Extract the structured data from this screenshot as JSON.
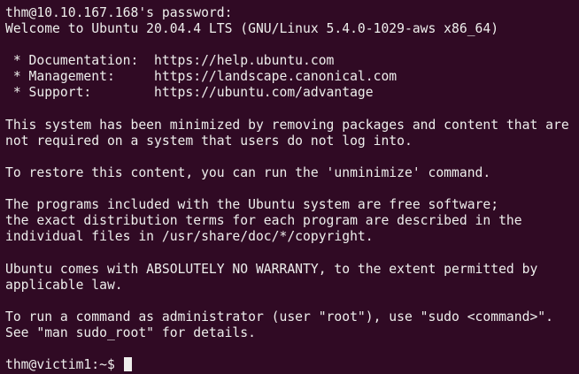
{
  "terminal": {
    "lines": [
      "thm@10.10.167.168's password:",
      "Welcome to Ubuntu 20.04.4 LTS (GNU/Linux 5.4.0-1029-aws x86_64)",
      "",
      " * Documentation:  https://help.ubuntu.com",
      " * Management:     https://landscape.canonical.com",
      " * Support:        https://ubuntu.com/advantage",
      "",
      "This system has been minimized by removing packages and content that are",
      "not required on a system that users do not log into.",
      "",
      "To restore this content, you can run the 'unminimize' command.",
      "",
      "The programs included with the Ubuntu system are free software;",
      "the exact distribution terms for each program are described in the",
      "individual files in /usr/share/doc/*/copyright.",
      "",
      "Ubuntu comes with ABSOLUTELY NO WARRANTY, to the extent permitted by",
      "applicable law.",
      "",
      "To run a command as administrator (user \"root\"), use \"sudo <command>\".",
      "See \"man sudo_root\" for details.",
      ""
    ],
    "prompt": "thm@victim1:~$ "
  }
}
